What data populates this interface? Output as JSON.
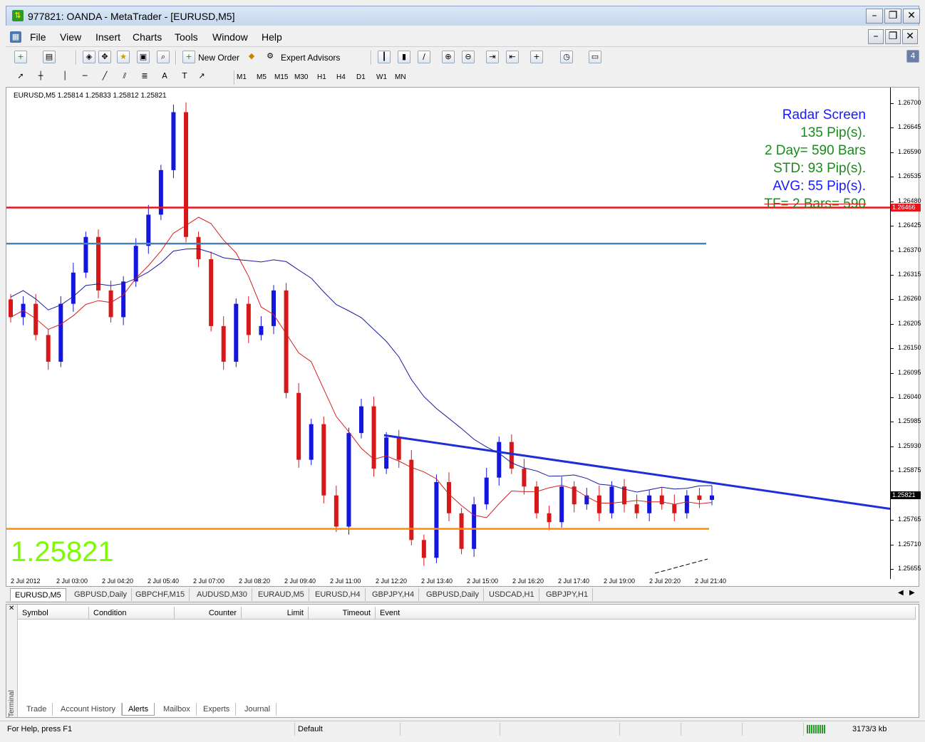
{
  "window": {
    "title": "977821: OANDA - MetaTrader - [EURUSD,M5]"
  },
  "menu": [
    "File",
    "View",
    "Insert",
    "Charts",
    "Tools",
    "Window",
    "Help"
  ],
  "toolbar": {
    "new_order": "New Order",
    "expert_advisors": "Expert Advisors"
  },
  "timeframes": [
    "M1",
    "M5",
    "M15",
    "M30",
    "H1",
    "H4",
    "D1",
    "W1",
    "MN"
  ],
  "drawing_tools": {
    "text_tool": "A"
  },
  "chart": {
    "info": "EURUSD,M5  1.25814 1.25833 1.25812 1.25821",
    "radar": {
      "title": "Radar Screen",
      "pips": "135 Pip(s).",
      "bars": "2 Day= 590 Bars",
      "std": "STD: 93 Pip(s).",
      "avg": "AVG: 55 Pip(s).",
      "tf": "TF= 2 Bars= 590"
    },
    "big_price": "1.25821",
    "red_line_price": "1.26466",
    "current_price": "1.25821",
    "colors": {
      "red_level": "#e8141c",
      "blue_level": "#4682b4",
      "support": "#ff8c00",
      "trendline": "#1f2ed8",
      "ma_fast": "#d42020",
      "ma_slow": "#1a1aa0",
      "bull": "#1515e0",
      "bear": "#d81818"
    }
  },
  "chart_data": {
    "type": "candlestick",
    "y_ticks": [
      "1.26700",
      "1.26645",
      "1.26590",
      "1.26535",
      "1.26480",
      "1.26425",
      "1.26370",
      "1.26315",
      "1.26260",
      "1.26205",
      "1.26150",
      "1.26095",
      "1.26040",
      "1.25985",
      "1.25930",
      "1.25875",
      "1.25820",
      "1.25765",
      "1.25710",
      "1.25655"
    ],
    "x_ticks": [
      "2 Jul 2012",
      "2 Jul 03:00",
      "2 Jul 04:20",
      "2 Jul 05:40",
      "2 Jul 07:00",
      "2 Jul 08:20",
      "2 Jul 09:40",
      "2 Jul 11:00",
      "2 Jul 12:20",
      "2 Jul 13:40",
      "2 Jul 15:00",
      "2 Jul 16:20",
      "2 Jul 17:40",
      "2 Jul 19:00",
      "2 Jul 20:20",
      "2 Jul 21:40"
    ],
    "ylim": [
      1.2563,
      1.2673
    ],
    "closes": [
      1.2622,
      1.2625,
      1.2618,
      1.2612,
      1.2625,
      1.2632,
      1.264,
      1.2628,
      1.2622,
      1.263,
      1.2638,
      1.2645,
      1.2655,
      1.2668,
      1.264,
      1.2635,
      1.262,
      1.2612,
      1.2625,
      1.2618,
      1.262,
      1.2628,
      1.2605,
      1.259,
      1.2598,
      1.2582,
      1.2575,
      1.2596,
      1.2602,
      1.2588,
      1.2595,
      1.259,
      1.2572,
      1.2568,
      1.2585,
      1.2578,
      1.257,
      1.258,
      1.2586,
      1.2594,
      1.2588,
      1.2584,
      1.2578,
      1.2576,
      1.2584,
      1.258,
      1.2582,
      1.2578,
      1.2584,
      1.258,
      1.2578,
      1.2582,
      1.258,
      1.2578,
      1.2582,
      1.2581,
      1.2582
    ],
    "levels": {
      "red": 1.26466,
      "blue": 1.26385,
      "support": 1.25745
    },
    "trendline": [
      [
        1.25955
      ],
      [
        1.2579
      ]
    ]
  },
  "chart_tabs": [
    "EURUSD,M5",
    "GBPUSD,Daily",
    "GBPCHF,M15",
    "AUDUSD,M30",
    "EURAUD,M5",
    "EURUSD,H4",
    "GBPJPY,H4",
    "GBPUSD,Daily",
    "USDCAD,H1",
    "GBPJPY,H1"
  ],
  "terminal": {
    "side_label": "Terminal",
    "columns": [
      "Symbol",
      "Condition",
      "Counter",
      "Limit",
      "Timeout",
      "Event"
    ],
    "tabs": [
      "Trade",
      "Account History",
      "Alerts",
      "Mailbox",
      "Experts",
      "Journal"
    ]
  },
  "status": {
    "help": "For Help, press F1",
    "profile": "Default",
    "traffic": "3173/3 kb"
  }
}
